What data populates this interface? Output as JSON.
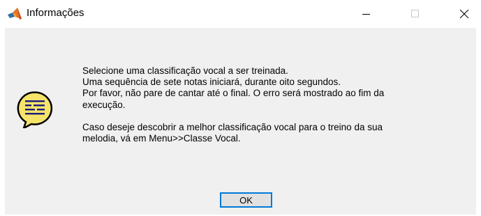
{
  "window": {
    "title": "Informações",
    "icon": "matlab-icon"
  },
  "titlebar_buttons": {
    "minimize_icon": "minimize-icon",
    "maximize_icon": "maximize-icon",
    "close_icon": "close-icon"
  },
  "dialog": {
    "icon": "help-speech-bubble-icon",
    "lines": [
      "Selecione uma classificação vocal a ser treinada.",
      "Uma sequência de sete notas iniciará, durante oito segundos.",
      "Por favor, não pare de cantar até o final. O erro será mostrado ao fim da",
      "execução.",
      "Caso deseje descobrir a melhor classificação vocal para o treino da sua",
      "melodia, vá em Menu>>Classe Vocal."
    ],
    "ok_label": "OK"
  },
  "colors": {
    "client_background": "#f0f0f0",
    "button_border": "#0078d7",
    "icon_fill": "#f5e46a"
  }
}
